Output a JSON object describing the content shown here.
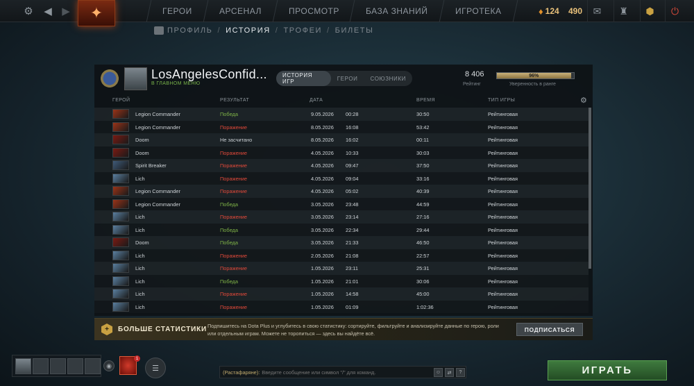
{
  "topbar": {
    "nav": [
      "ГЕРОИ",
      "АРСЕНАЛ",
      "ПРОСМОТР",
      "БАЗА ЗНАНИЙ",
      "ИГРОТЕКА"
    ],
    "shards": "124",
    "level": "490",
    "icons": [
      "gear-icon",
      "back-icon",
      "forward-icon",
      "dota-logo-icon",
      "mail-icon",
      "inventory-icon",
      "upgrade-icon",
      "plus-icon",
      "power-icon"
    ]
  },
  "subnav": {
    "items": [
      "ПРОФИЛЬ",
      "ИСТОРИЯ",
      "ТРОФЕИ",
      "БИЛЕТЫ"
    ],
    "active": "ИСТОРИЯ"
  },
  "profile": {
    "username": "LosAngelesConfid...",
    "status": "В ГЛАВНОМ МЕНЮ",
    "tabs": [
      "ИСТОРИЯ ИГР",
      "ГЕРОИ",
      "СОЮЗНИКИ"
    ],
    "active_tab": "ИСТОРИЯ ИГР",
    "rating_value": "8 406",
    "rating_label": "Рейтинг",
    "confidence_value": "96%",
    "confidence_fraction": 0.96,
    "confidence_label": "Уверенность в ранге"
  },
  "table": {
    "headers": [
      "ГЕРОЙ",
      "РЕЗУЛЬТАТ",
      "ДАТА",
      "ВРЕМЯ",
      "ТИП ИГРЫ"
    ],
    "rows": [
      {
        "hero": "Legion Commander",
        "result": "Победа",
        "date": "9.05.2026",
        "time": "00:28",
        "duration": "30:50",
        "type": "Рейтинговая"
      },
      {
        "hero": "Legion Commander",
        "result": "Поражение",
        "date": "8.05.2026",
        "time": "16:08",
        "duration": "53:42",
        "type": "Рейтинговая"
      },
      {
        "hero": "Doom",
        "result": "Не засчитано",
        "date": "8.05.2026",
        "time": "16:02",
        "duration": "00:11",
        "type": "Рейтинговая"
      },
      {
        "hero": "Doom",
        "result": "Поражение",
        "date": "4.05.2026",
        "time": "10:33",
        "duration": "30:03",
        "type": "Рейтинговая"
      },
      {
        "hero": "Spirit Breaker",
        "result": "Поражение",
        "date": "4.05.2026",
        "time": "09:47",
        "duration": "37:50",
        "type": "Рейтинговая"
      },
      {
        "hero": "Lich",
        "result": "Поражение",
        "date": "4.05.2026",
        "time": "09:04",
        "duration": "33:16",
        "type": "Рейтинговая"
      },
      {
        "hero": "Legion Commander",
        "result": "Поражение",
        "date": "4.05.2026",
        "time": "05:02",
        "duration": "40:39",
        "type": "Рейтинговая"
      },
      {
        "hero": "Legion Commander",
        "result": "Победа",
        "date": "3.05.2026",
        "time": "23:48",
        "duration": "44:59",
        "type": "Рейтинговая"
      },
      {
        "hero": "Lich",
        "result": "Поражение",
        "date": "3.05.2026",
        "time": "23:14",
        "duration": "27:16",
        "type": "Рейтинговая"
      },
      {
        "hero": "Lich",
        "result": "Победа",
        "date": "3.05.2026",
        "time": "22:34",
        "duration": "29:44",
        "type": "Рейтинговая"
      },
      {
        "hero": "Doom",
        "result": "Победа",
        "date": "3.05.2026",
        "time": "21:33",
        "duration": "46:50",
        "type": "Рейтинговая"
      },
      {
        "hero": "Lich",
        "result": "Поражение",
        "date": "2.05.2026",
        "time": "21:08",
        "duration": "22:57",
        "type": "Рейтинговая"
      },
      {
        "hero": "Lich",
        "result": "Поражение",
        "date": "1.05.2026",
        "time": "23:11",
        "duration": "25:31",
        "type": "Рейтинговая"
      },
      {
        "hero": "Lich",
        "result": "Победа",
        "date": "1.05.2026",
        "time": "21:01",
        "duration": "30:06",
        "type": "Рейтинговая"
      },
      {
        "hero": "Lich",
        "result": "Поражение",
        "date": "1.05.2026",
        "time": "14:58",
        "duration": "45:00",
        "type": "Рейтинговая"
      },
      {
        "hero": "Lich",
        "result": "Поражение",
        "date": "1.05.2026",
        "time": "01:09",
        "duration": "1:02:36",
        "type": "Рейтинговая"
      }
    ]
  },
  "colors": {
    "win": "#7fb347",
    "loss": "#e0493a",
    "neutral": "#c9ced2",
    "hero_legion_commander": "#9a3318",
    "hero_doom": "#7a1a12",
    "hero_spirit_breaker": "#3e5a78",
    "hero_lich": "#5a7fa0"
  },
  "dota_plus": {
    "title": "БОЛЬШЕ СТАТИСТИКИ",
    "text": "Подпишитесь на Dota Plus и углубитесь в свою статистику: сортируйте, фильтруйте и анализируйте данные по герою, роли или отдельным играм. Можете не торопиться — здесь вы найдёте всё.",
    "button": "ПОДПИСАТЬСЯ"
  },
  "bottom": {
    "event_badge": "1",
    "chat_channel": "(Растафаряне):",
    "chat_placeholder": "Введите сообщение или символ \"/\" для команд.",
    "chat_help": "?",
    "play": "ИГРАТЬ"
  }
}
